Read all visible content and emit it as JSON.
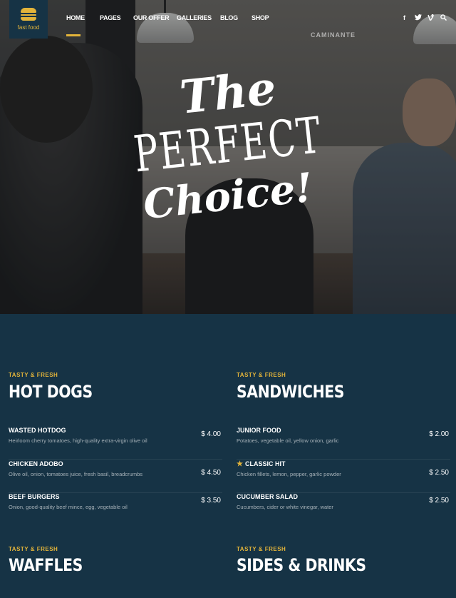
{
  "logo": {
    "text": "fast food"
  },
  "nav": {
    "items": [
      "HOME",
      "PAGES",
      "OUR OFFER",
      "GALLERIES",
      "BLOG",
      "SHOP"
    ]
  },
  "social": {
    "icons": [
      "facebook-icon",
      "twitter-icon",
      "vine-icon",
      "search-icon"
    ],
    "glyphs": [
      "f",
      "t",
      "v",
      "q"
    ]
  },
  "hero": {
    "sign": "CAMINANTE",
    "title_line1": "The",
    "title_line2": "PERFECT",
    "title_line3": "Choice!"
  },
  "menu": {
    "left": {
      "kicker": "TASTY & FRESH",
      "title": "HOT DOGS",
      "items": [
        {
          "name": "WASTED HOTDOG",
          "desc": "Heirloom cherry tomatoes, high-quality extra-virgin olive oil",
          "price": "$ 4.00"
        },
        {
          "name": "CHICKEN ADOBO",
          "desc": "Olive oil, onion, tomatoes juice, fresh basil, breadcrumbs",
          "price": "$ 4.50"
        },
        {
          "name": "BEEF BURGERS",
          "desc": "Onion, good-quality beef mince, egg, vegetable oil",
          "price": "$ 3.50"
        }
      ],
      "kicker2": "TASTY & FRESH",
      "title2": "WAFFLES"
    },
    "right": {
      "kicker": "TASTY & FRESH",
      "title": "SANDWICHES",
      "items": [
        {
          "name": "JUNIOR FOOD",
          "desc": "Potatoes, vegetable oil, yellow onion, garlic",
          "price": "$ 2.00"
        },
        {
          "name": "CLASSIC HIT",
          "desc": "Chicken fillets, lemon, pepper, garlic powder",
          "price": "$ 2.50"
        },
        {
          "name": "CUCUMBER SALAD",
          "desc": "Cucumbers, cider or white vinegar, water",
          "price": "$ 2.50"
        }
      ],
      "kicker2": "TASTY & FRESH",
      "title2": "SIDES & DRINKS"
    }
  },
  "colors": {
    "accent": "#e3b43a",
    "background": "#163345"
  }
}
